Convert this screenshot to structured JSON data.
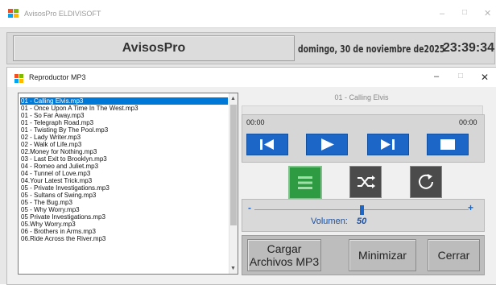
{
  "outer_window": {
    "title": "AvisosPro ELDIVISOFT",
    "min_label": "–",
    "max_label": "□",
    "close_label": "✕"
  },
  "header": {
    "app_title": "AvisosPro",
    "date": "domingo, 30 de noviembre de2025",
    "time": "23:39:34"
  },
  "inner_window": {
    "title": "Reproductor MP3",
    "min_label": "–",
    "max_label": "□",
    "close_label": "✕"
  },
  "playlist": {
    "selected_index": 0,
    "items": [
      "01 - Calling Elvis.mp3",
      "01 - Once Upon A Time In The West.mp3",
      "01 - So Far Away.mp3",
      "01 - Telegraph Road.mp3",
      "01 - Twisting By The Pool.mp3",
      "02 - Lady Writer.mp3",
      "02 - Walk of Life.mp3",
      "02.Money for Nothing.mp3",
      "03 - Last Exit to Brooklyn.mp3",
      "04 - Romeo and Juliet.mp3",
      "04 - Tunnel of Love.mp3",
      "04.Your Latest Trick.mp3",
      "05 - Private Investigations.mp3",
      "05 - Sultans of Swing.mp3",
      "05 - The Bug.mp3",
      "05 - Why Worry.mp3",
      "05 Private Investigations.mp3",
      "05.Why Worry.mp3",
      "06 - Brothers in Arms.mp3",
      "06.Ride Across the River.mp3"
    ]
  },
  "player": {
    "track_title": "01 - Calling Elvis",
    "time_start": "00:00",
    "time_end": "00:00",
    "progress": 0,
    "volume_label": "Volumen:",
    "volume_value": "50",
    "volume_level": 0.5,
    "vol_minus": "-",
    "vol_plus": "+"
  },
  "buttons": {
    "load": "Cargar Archivos MP3",
    "minimize": "Minimizar",
    "close": "Cerrar"
  },
  "icons": {
    "prev": "skip-previous-icon",
    "play": "play-icon",
    "next": "skip-next-icon",
    "stop": "stop-icon",
    "list": "list-icon",
    "shuffle": "shuffle-icon",
    "repeat": "repeat-icon"
  },
  "colors": {
    "accent_blue": "#1c66c7",
    "selection_blue": "#0078d7",
    "list_green": "#2e9a41"
  }
}
